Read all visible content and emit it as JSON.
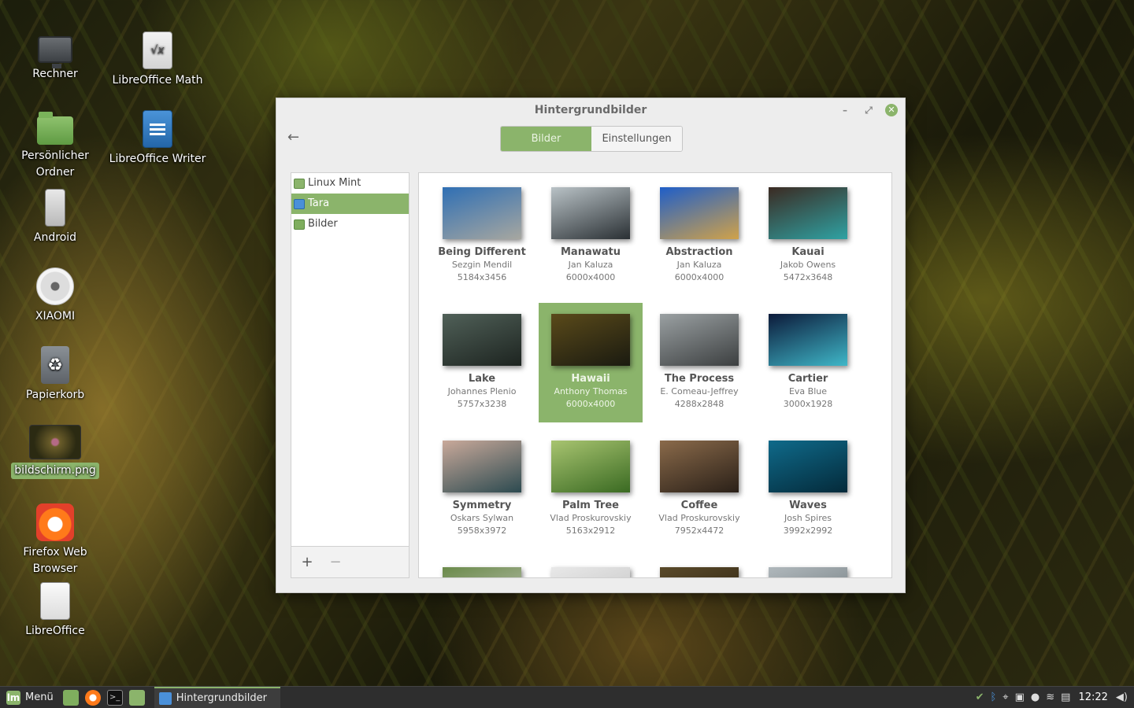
{
  "desktop": {
    "icons": [
      {
        "label": "Rechner",
        "icon": "computer-icon"
      },
      {
        "label": "LibreOffice Math",
        "icon": "libreoffice-math-icon"
      },
      {
        "label": "Persönlicher Ordner",
        "icon": "home-folder-icon"
      },
      {
        "label": "LibreOffice Writer",
        "icon": "libreoffice-writer-icon"
      },
      {
        "label": "Android",
        "icon": "phone-icon"
      },
      {
        "label": "XIAOMI",
        "icon": "disc-icon"
      },
      {
        "label": "Papierkorb",
        "icon": "trash-icon"
      },
      {
        "label": "bildschirm.png",
        "icon": "image-thumbnail-icon"
      },
      {
        "label": "Firefox Web Browser",
        "icon": "firefox-icon"
      },
      {
        "label": "LibreOffice",
        "icon": "libreoffice-icon"
      }
    ]
  },
  "window": {
    "title": "Hintergrundbilder",
    "minimize": "–",
    "maximize": "⤢",
    "close": "✕",
    "back": "←",
    "tabs": [
      "Bilder",
      "Einstellungen"
    ],
    "active_tab": "Bilder"
  },
  "sidebar": {
    "items": [
      {
        "label": "Linux Mint",
        "icon": "mint-icon"
      },
      {
        "label": "Tara",
        "icon": "user-icon"
      },
      {
        "label": "Bilder",
        "icon": "folder-icon"
      }
    ],
    "selected": "Tara",
    "add": "+",
    "remove": "−"
  },
  "wallpapers": [
    {
      "name": "Being Different",
      "author": "Sezgin Mendil",
      "size": "5184x3456",
      "colors": [
        "#2f6fb4",
        "#a7a7a0"
      ]
    },
    {
      "name": "Manawatu",
      "author": "Jan Kaluza",
      "size": "6000x4000",
      "colors": [
        "#b9c2c6",
        "#2a3034"
      ]
    },
    {
      "name": "Abstraction",
      "author": "Jan Kaluza",
      "size": "6000x4000",
      "colors": [
        "#1f5ec8",
        "#d0a24a"
      ]
    },
    {
      "name": "Kauai",
      "author": "Jakob Owens",
      "size": "5472x3648",
      "colors": [
        "#3b2a22",
        "#2fa2a3"
      ]
    },
    {
      "name": "Lake",
      "author": "Johannes Plenio",
      "size": "5757x3238",
      "colors": [
        "#506058",
        "#1d2420"
      ]
    },
    {
      "name": "Hawaii",
      "author": "Anthony Thomas",
      "size": "6000x4000",
      "colors": [
        "#5a4a1a",
        "#1a1a10"
      ]
    },
    {
      "name": "The Process",
      "author": "E. Comeau-Jeffrey",
      "size": "4288x2848",
      "colors": [
        "#9aa0a2",
        "#3c3f40"
      ]
    },
    {
      "name": "Cartier",
      "author": "Eva Blue",
      "size": "3000x1928",
      "colors": [
        "#0c1a3a",
        "#3fb7c8"
      ]
    },
    {
      "name": "Symmetry",
      "author": "Oskars Sylwan",
      "size": "5958x3972",
      "colors": [
        "#c9a99a",
        "#2c4a50"
      ]
    },
    {
      "name": "Palm Tree",
      "author": "Vlad Proskurovskiy",
      "size": "5163x2912",
      "colors": [
        "#a8c470",
        "#3a6a22"
      ]
    },
    {
      "name": "Coffee",
      "author": "Vlad Proskurovskiy",
      "size": "7952x4472",
      "colors": [
        "#8a6a4a",
        "#2a2018"
      ]
    },
    {
      "name": "Waves",
      "author": "Josh Spires",
      "size": "3992x2992",
      "colors": [
        "#0f6a8a",
        "#042a3a"
      ]
    },
    {
      "name": "",
      "author": "",
      "size": "",
      "colors": [
        "#6a8a4a",
        "#c8c8c0"
      ]
    },
    {
      "name": "",
      "author": "",
      "size": "",
      "colors": [
        "#e8e8e8",
        "#c0c0c0"
      ]
    },
    {
      "name": "",
      "author": "",
      "size": "",
      "colors": [
        "#5a4a2a",
        "#2a2010"
      ]
    },
    {
      "name": "",
      "author": "",
      "size": "",
      "colors": [
        "#b0b8bc",
        "#6a7478"
      ]
    }
  ],
  "selected_wallpaper": "Hawaii",
  "taskbar": {
    "menu_label": "Menü",
    "task_label": "Hintergrundbilder",
    "clock": "12:22",
    "tray_icons": [
      "shield-icon",
      "bluetooth-icon",
      "location-icon",
      "display-icon",
      "user-icon",
      "wifi-icon",
      "clipboard-icon",
      "volume-icon"
    ]
  }
}
